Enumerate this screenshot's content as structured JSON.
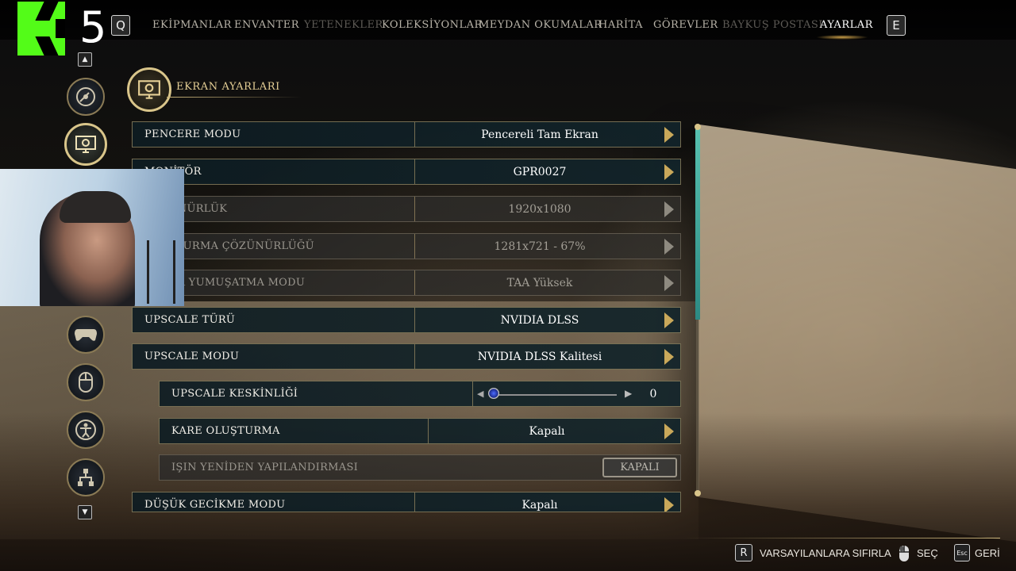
{
  "stream_overlay": {
    "logo_number": "5"
  },
  "nav": {
    "prev_key": "Q",
    "next_key": "E",
    "items": [
      {
        "label": "EKİPMANLAR",
        "state": "normal"
      },
      {
        "label": "ENVANTER",
        "state": "normal"
      },
      {
        "label": "YETENEKLER",
        "state": "dim"
      },
      {
        "label": "KOLEKSİYONLAR",
        "state": "normal"
      },
      {
        "label": "MEYDAN OKUMALAR",
        "state": "normal"
      },
      {
        "label": "HARİTA",
        "state": "normal"
      },
      {
        "label": "GÖREVLER",
        "state": "normal"
      },
      {
        "label": "BAYKUŞ POSTASI",
        "state": "dim"
      },
      {
        "label": "AYARLAR",
        "state": "active"
      }
    ]
  },
  "section": {
    "title": "EKRAN AYARLARI"
  },
  "settings": [
    {
      "label": "PENCERE MODU",
      "value": "Pencereli Tam Ekran",
      "enabled": true
    },
    {
      "label": "MONİTÖR",
      "value": "GPR0027",
      "enabled": true
    },
    {
      "label": "ÇÖZÜNÜRLÜK",
      "value": "1920x1080",
      "enabled": false
    },
    {
      "label": "OLUŞTURMA ÇÖZÜNÜRLÜĞÜ",
      "value": "1281x721 - 67%",
      "enabled": false
    },
    {
      "label": "KENAR YUMUŞATMA MODU",
      "value": "TAA Yüksek",
      "enabled": false
    },
    {
      "label": "UPSCALE TÜRÜ",
      "value": "NVIDIA DLSS",
      "enabled": true
    },
    {
      "label": "UPSCALE MODU",
      "value": "NVIDIA DLSS Kalitesi",
      "enabled": true
    },
    {
      "label": "UPSCALE KESKİNLİĞİ",
      "value": "0",
      "slider_fraction": 0.0,
      "enabled": true
    },
    {
      "label": "KARE OLUŞTURMA",
      "value": "Kapalı",
      "enabled": true
    },
    {
      "label": "IŞIN YENİDEN YAPILANDIRMASI",
      "value": "KAPALI",
      "enabled": false
    },
    {
      "label": "DÜŞÜK GECİKME MODU",
      "value": "Kapalı",
      "enabled": true
    }
  ],
  "footer": {
    "reset_key": "R",
    "reset_label": "VARSAYILANLARA SIFIRLA",
    "select_label": "SEÇ",
    "back_key": "Esc",
    "back_label": "GERİ"
  },
  "colors": {
    "accent_gold": "#d9c58a",
    "scroll_teal": "#57c1b0",
    "kick_green": "#53fc18"
  }
}
